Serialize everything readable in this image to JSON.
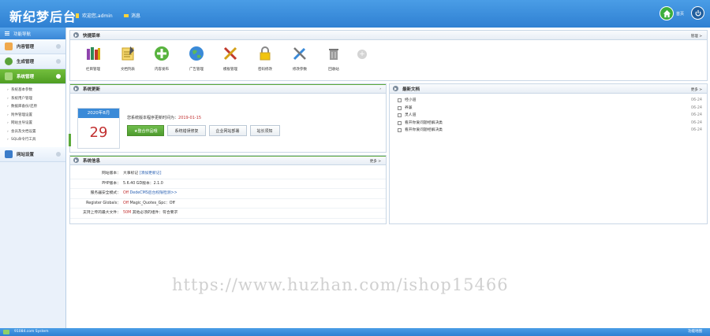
{
  "header": {
    "logo": "新纪梦后台",
    "welcome": "欢迎您,admin",
    "message": "消息",
    "home_label": "首页"
  },
  "sidebar": {
    "title": "功能导航",
    "categories": [
      {
        "label": "内容管理"
      },
      {
        "label": "生成管理"
      },
      {
        "label": "系统管理",
        "active": true
      },
      {
        "label": "网站设置"
      }
    ],
    "sub_items": [
      "系统基本参数",
      "系统用户管理",
      "数据库备份/还原",
      "附件管理设置",
      "网站主导设置",
      "会员及文档设置",
      "SQL命令行工具"
    ]
  },
  "quick": {
    "title": "快捷菜单",
    "manage": "管理 >",
    "items": [
      {
        "label": "栏目管理",
        "icon": "books-icon"
      },
      {
        "label": "文档列表",
        "icon": "notepad-icon"
      },
      {
        "label": "内容发布",
        "icon": "plus-icon"
      },
      {
        "label": "广告管理",
        "icon": "globe-icon"
      },
      {
        "label": "模板管理",
        "icon": "tools-icon"
      },
      {
        "label": "密码修改",
        "icon": "lock-icon"
      },
      {
        "label": "修改参数",
        "icon": "wrench-icon"
      },
      {
        "label": "回收站",
        "icon": "trash-icon"
      }
    ]
  },
  "update": {
    "title": "系统更新",
    "month": "2020年8月",
    "day": "29",
    "text_prefix": "您系统版本程序更新时间为：",
    "date": "2019-01-15",
    "buttons": [
      "★整合作品哦",
      "系统错误修复",
      "企业网站部署",
      "站长须知"
    ]
  },
  "articles": {
    "title": "最新文档",
    "more": "更多 >",
    "items": [
      {
        "title": "经小道",
        "date": "06-24"
      },
      {
        "title": "养兼",
        "date": "06-24"
      },
      {
        "title": "灵人道",
        "date": "06-24"
      },
      {
        "title": "看开你爱问题经解决类",
        "date": "06-24"
      },
      {
        "title": "看开你爱问题经解决类",
        "date": "06-24"
      }
    ]
  },
  "sysinfo": {
    "title": "系统信息",
    "more": "更多 >",
    "rows": [
      {
        "k": "网站版本：",
        "v1": "大事标记 ",
        "v2": "[添加更新记]",
        "v3": ""
      },
      {
        "k": "PHP版本：",
        "v1": "5.6.40   GD版本：2.1.0",
        "v2": "",
        "v3": ""
      },
      {
        "k": "服务器安全模式：",
        "v1": "",
        "v2": "Off",
        "v3": "   DedeCMS后台权限检测>>"
      },
      {
        "k": "Register Globals：",
        "v1": "",
        "v2": "Off",
        "v3": "   Magic_Quotes_Gpc：Off"
      },
      {
        "k": "支持上传的最大文件：",
        "v1": "",
        "v2": "50M",
        "v3": "   其他必须的组件：符合要求"
      }
    ]
  },
  "watermark": "https://www.huzhan.com/ishop15466",
  "footer": {
    "left": "91084.com System",
    "right": "功能地图"
  }
}
